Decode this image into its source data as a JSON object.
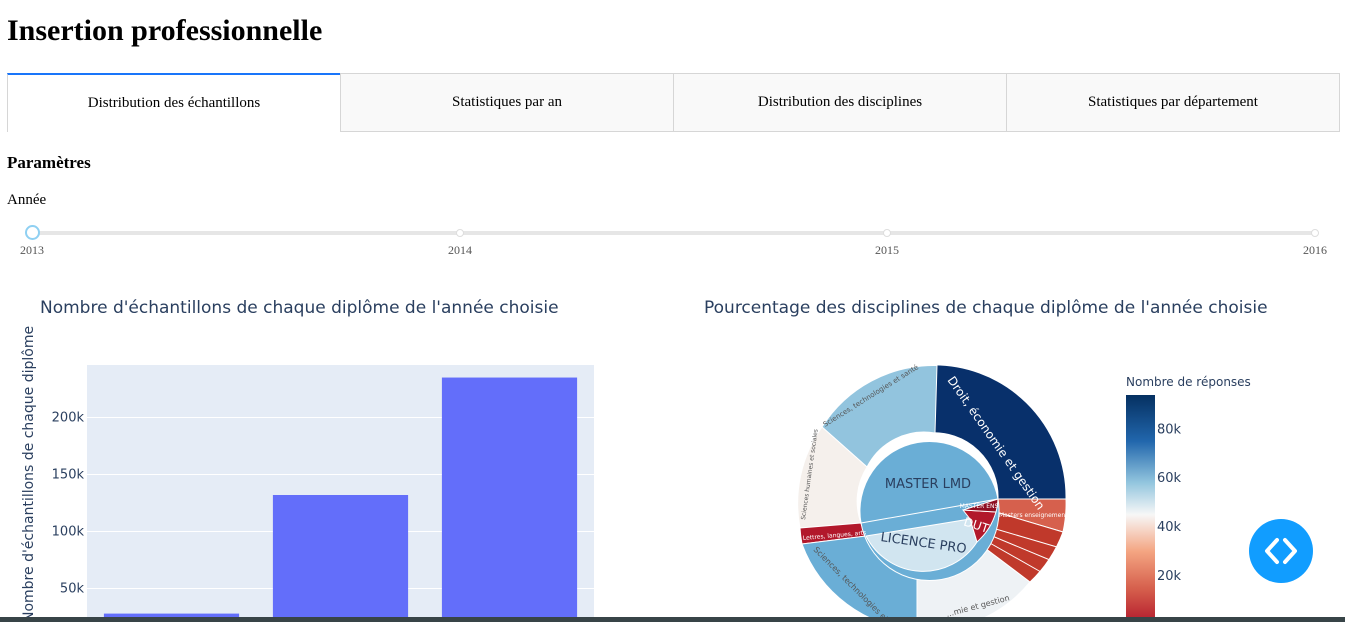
{
  "page": {
    "title": "Insertion professionnelle"
  },
  "tabs": [
    {
      "label": "Distribution des échantillons",
      "active": true
    },
    {
      "label": "Statistiques par an",
      "active": false
    },
    {
      "label": "Distribution des disciplines",
      "active": false
    },
    {
      "label": "Statistiques par département",
      "active": false
    }
  ],
  "params": {
    "heading": "Paramètres",
    "year_label": "Année",
    "slider": {
      "marks": [
        "2013",
        "2014",
        "2015",
        "2016"
      ],
      "selected": "2013"
    }
  },
  "bar_chart": {
    "title": "Nombre d'échantillons de chaque diplôme de l'année choisie",
    "ylabel": "Nombre d'échantillons de chaque diplôme"
  },
  "sunburst": {
    "title": "Pourcentage des disciplines de chaque diplôme de l'année choisie",
    "center_labels": [
      "MASTER LMD",
      "LICENCE PRO",
      "DUT",
      "MASTER ENS"
    ],
    "outer_labels": [
      "Droit, économie et gestion",
      "Sciences, technologies et santé",
      "Sciences humaines et sociales",
      "Lettres, langues, arts",
      "Sciences, technologies et sa...",
      "...mie et gestion",
      "Masters enseignement"
    ],
    "colorbar": {
      "title": "Nombre de réponses",
      "ticks": [
        "20k",
        "40k",
        "60k",
        "80k"
      ],
      "min": 0,
      "max": 94000
    }
  },
  "chart_data": [
    {
      "type": "bar",
      "title": "Nombre d'échantillons de chaque diplôme de l'année choisie",
      "ylabel": "Nombre d'échantillons de chaque diplôme",
      "values": [
        28000,
        132000,
        235000
      ],
      "yticks": [
        "50k",
        "100k",
        "150k",
        "200k"
      ],
      "ylim": [
        18000,
        246000
      ],
      "color": "#636EFA",
      "background": "#E5ECF6"
    },
    {
      "type": "sunburst",
      "title": "Pourcentage des disciplines de chaque diplôme de l'année choisie"
    }
  ]
}
